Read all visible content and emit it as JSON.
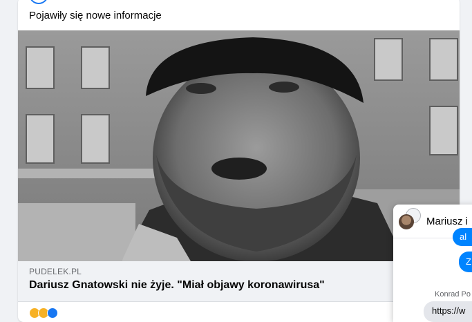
{
  "post": {
    "text": "Pojawiły się nowe informacje",
    "link": {
      "domain": "PUDELEK.PL",
      "title": "Dariusz Gnatowski nie żyje. \"Miał objawy koronawirusa\""
    }
  },
  "chat": {
    "name": "Mariusz i",
    "bubble_1": "al",
    "bubble_2": "Z",
    "sender": "Konrad Po",
    "incoming": "https://w"
  },
  "colors": {
    "accent": "#1877f2",
    "messenger_blue": "#0084ff",
    "background": "#f0f2f5"
  }
}
